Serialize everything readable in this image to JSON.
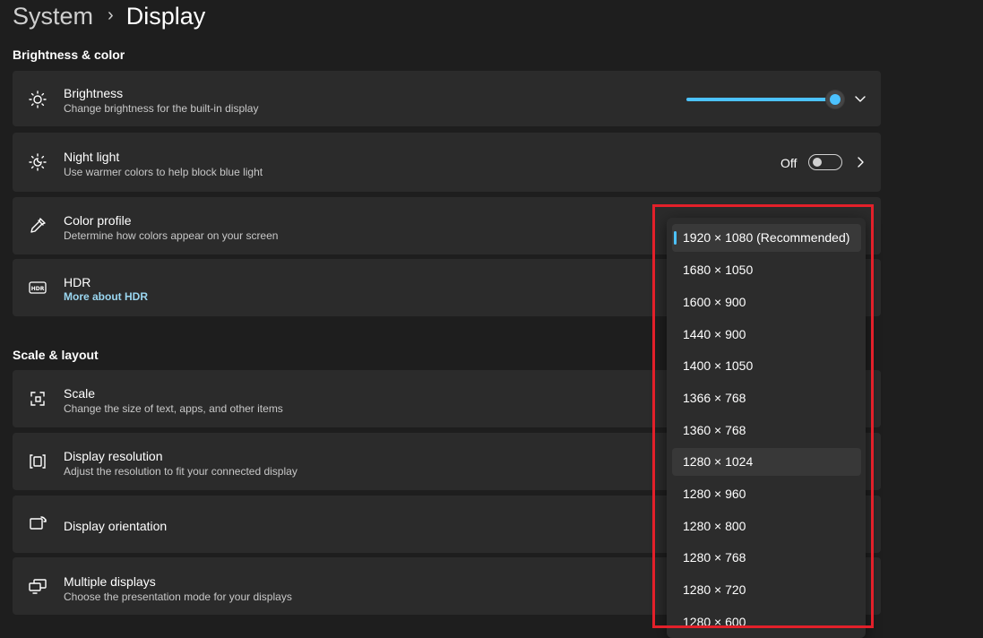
{
  "breadcrumb": {
    "parent": "System",
    "separator": "›",
    "current": "Display"
  },
  "sections": {
    "brightness_color": "Brightness & color",
    "scale_layout": "Scale & layout"
  },
  "cards": {
    "brightness": {
      "title": "Brightness",
      "subtitle": "Change brightness for the built-in display",
      "value": 1.0
    },
    "night_light": {
      "title": "Night light",
      "subtitle": "Use warmer colors to help block blue light",
      "state": "Off"
    },
    "color_profile": {
      "title": "Color profile",
      "subtitle": "Determine how colors appear on your screen"
    },
    "hdr": {
      "title": "HDR",
      "link": "More about HDR"
    },
    "scale": {
      "title": "Scale",
      "subtitle": "Change the size of text, apps, and other items"
    },
    "resolution": {
      "title": "Display resolution",
      "subtitle": "Adjust the resolution to fit your connected display"
    },
    "orientation": {
      "title": "Display orientation"
    },
    "multiple": {
      "title": "Multiple displays",
      "subtitle": "Choose the presentation mode for your displays"
    }
  },
  "resolution_options": [
    "1920 × 1080 (Recommended)",
    "1680 × 1050",
    "1600 × 900",
    "1440 × 900",
    "1400 × 1050",
    "1366 × 768",
    "1360 × 768",
    "1280 × 1024",
    "1280 × 960",
    "1280 × 800",
    "1280 × 768",
    "1280 × 720",
    "1280 × 600"
  ],
  "selected_resolution": "1920 × 1080 (Recommended)",
  "hovered_resolution": "1280 × 1024",
  "colors": {
    "accent": "#4cc2ff",
    "highlight_box": "#e3202a",
    "card": "#2b2b2b",
    "background": "#1e1e1e"
  },
  "icons": {
    "brightness": "sun-icon",
    "night_light": "night-light-icon",
    "color_profile": "eyedropper-icon",
    "hdr": "hdr-icon",
    "scale": "scale-icon",
    "resolution": "resolution-icon",
    "orientation": "orientation-icon",
    "multiple": "multiple-displays-icon"
  }
}
